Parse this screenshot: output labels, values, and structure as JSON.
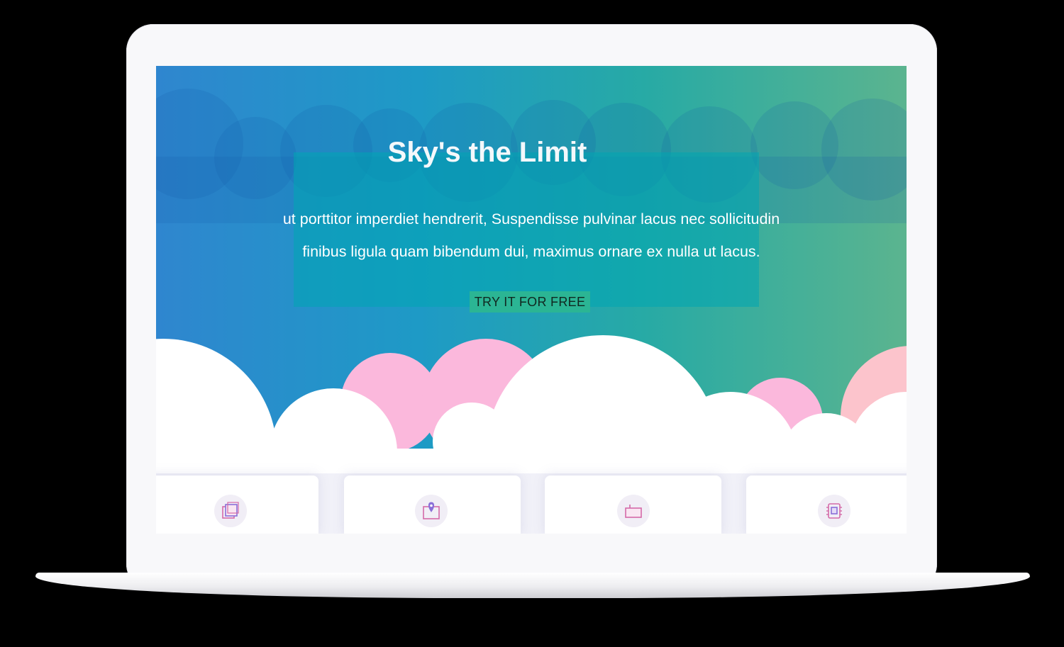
{
  "hero": {
    "title": "Sky's the Limit",
    "text_line_1": "ut porttitor imperdiet hendrerit, Suspendisse pulvinar lacus nec sollicitudin",
    "text_line_2": "finibus ligula quam bibendum dui, maximus ornare ex nulla ut lacus.",
    "cta_label": "TRY IT FOR FREE"
  },
  "features": [
    {
      "icon": "stacked-squares-icon"
    },
    {
      "icon": "location-pin-icon"
    },
    {
      "icon": "folder-icon"
    },
    {
      "icon": "chip-icon"
    }
  ],
  "colors": {
    "gradient_start": "#2f86cf",
    "gradient_end": "#5bb48f",
    "cta_background": "#2bb594",
    "cloud_pink": "#fbb8dc",
    "icon_stroke": "#d46aa8",
    "icon_accent": "#8a6fd8"
  }
}
